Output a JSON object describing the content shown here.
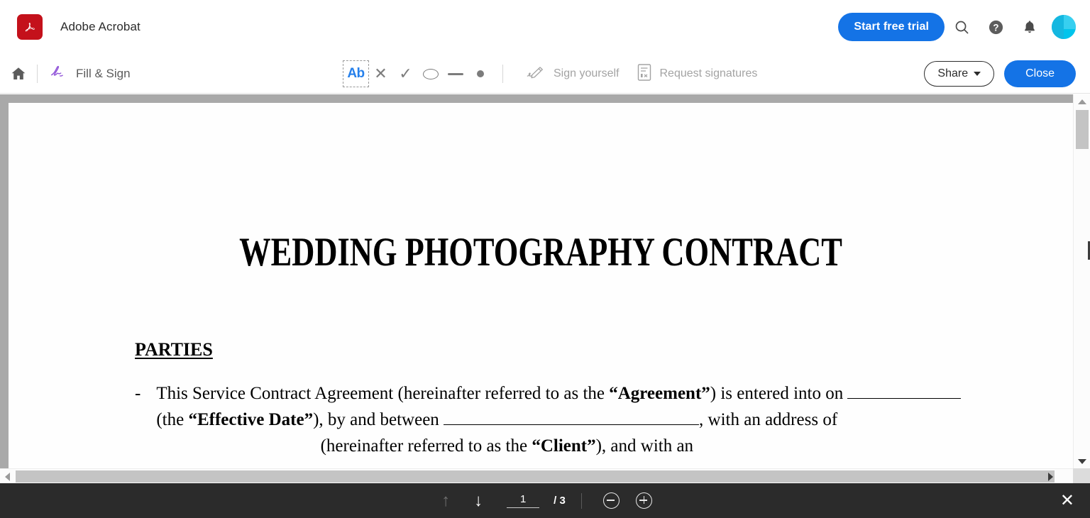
{
  "appbar": {
    "logo_icon": "acrobat-logo-icon",
    "logo_glyph": "A",
    "title": "Adobe Acrobat",
    "trial_button": "Start free trial",
    "search_icon": "search-icon",
    "help_icon": "help-icon",
    "notifications_icon": "bell-icon",
    "avatar_icon": "avatar",
    "accent_blue": "#1473e6",
    "logo_red": "#c4111b"
  },
  "toolbar": {
    "home_icon": "home-icon",
    "fill_sign_icon": "fill-sign-icon",
    "fill_sign_label": "Fill & Sign",
    "tools": [
      {
        "name": "add-text-tool",
        "glyph": "Ab",
        "selected": true
      },
      {
        "name": "cross-mark-tool",
        "glyph": "✕",
        "selected": false
      },
      {
        "name": "check-mark-tool",
        "glyph": "✓",
        "selected": false
      },
      {
        "name": "circle-tool",
        "glyph": "oval",
        "selected": false
      },
      {
        "name": "line-tool",
        "glyph": "line",
        "selected": false
      },
      {
        "name": "dot-tool",
        "glyph": "dot",
        "selected": false
      }
    ],
    "sign_yourself_label": "Sign yourself",
    "sign_yourself_icon": "signature-icon",
    "request_signatures_label": "Request signatures",
    "request_signatures_icon": "request-signature-doc-icon",
    "share_label": "Share",
    "share_caret_icon": "chevron-down-icon",
    "close_label": "Close"
  },
  "document": {
    "title": "WEDDING PHOTOGRAPHY CONTRACT",
    "section_heading": "PARTIES",
    "bullet": "-",
    "paragraph": {
      "part1": "This Service Contract Agreement (hereinafter referred to as the ",
      "bold1": "“Agreement”",
      "part2": ") is entered into on ",
      "part3": " (the ",
      "bold2": "“Effective Date”",
      "part4": "), by and between ",
      "part5": ", with an address of ",
      "part6": " (hereinafter referred to as the ",
      "bold3": "“Client”",
      "part7": "), and with an"
    }
  },
  "scrollbars": {
    "vertical_up_icon": "scroll-up-arrow-icon",
    "vertical_down_icon": "scroll-down-arrow-icon",
    "horizontal_left_icon": "scroll-left-arrow-icon",
    "horizontal_right_icon": "scroll-right-arrow-icon"
  },
  "bottombar": {
    "prev_page_icon": "arrow-up-icon",
    "prev_page_glyph": "↑",
    "next_page_icon": "arrow-down-icon",
    "next_page_glyph": "↓",
    "current_page": "1",
    "page_count": "/ 3",
    "zoom_out_icon": "zoom-out-icon",
    "zoom_in_icon": "zoom-in-icon",
    "close_icon": "close-icon",
    "close_glyph": "✕",
    "background": "#2b2b2b"
  }
}
